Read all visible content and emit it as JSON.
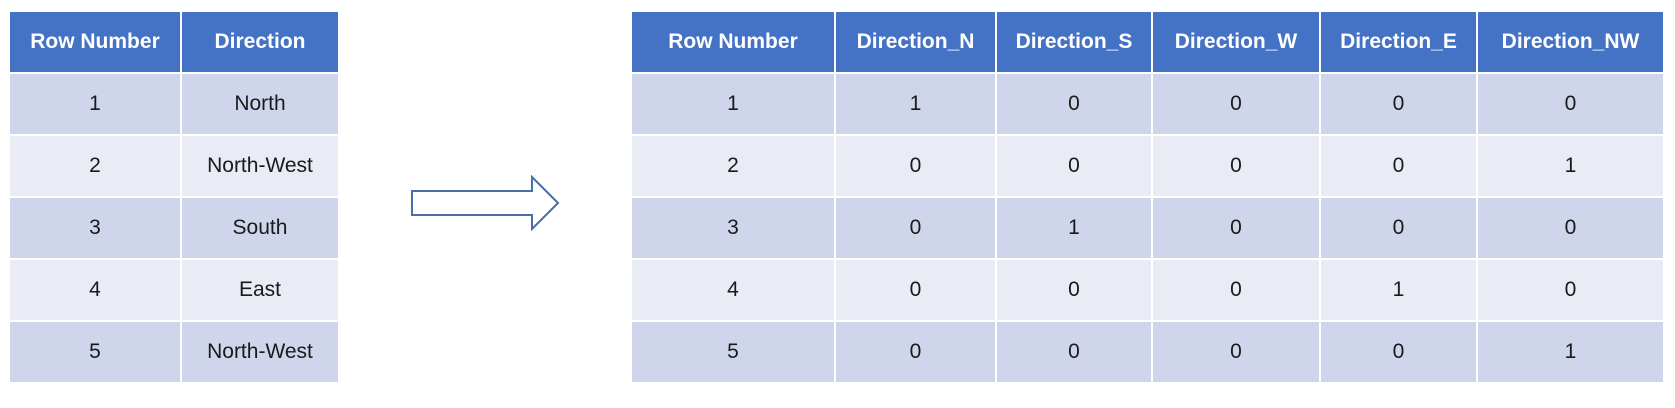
{
  "left_table": {
    "headers": [
      "Row Number",
      "Direction"
    ],
    "rows": [
      [
        "1",
        "North"
      ],
      [
        "2",
        "North-West"
      ],
      [
        "3",
        "South"
      ],
      [
        "4",
        "East"
      ],
      [
        "5",
        "North-West"
      ]
    ]
  },
  "right_table": {
    "headers": [
      "Row Number",
      "Direction_N",
      "Direction_S",
      "Direction_W",
      "Direction_E",
      "Direction_NW"
    ],
    "rows": [
      [
        "1",
        "1",
        "0",
        "0",
        "0",
        "0"
      ],
      [
        "2",
        "0",
        "0",
        "0",
        "0",
        "1"
      ],
      [
        "3",
        "0",
        "1",
        "0",
        "0",
        "0"
      ],
      [
        "4",
        "0",
        "0",
        "0",
        "1",
        "0"
      ],
      [
        "5",
        "0",
        "0",
        "0",
        "0",
        "1"
      ]
    ]
  },
  "colors": {
    "header_bg": "#4472c4",
    "row_odd": "#cfd5ea",
    "row_even": "#e9ebf5",
    "arrow_stroke": "#4a6fa5"
  },
  "icons": {
    "arrow": "right-arrow-icon"
  }
}
